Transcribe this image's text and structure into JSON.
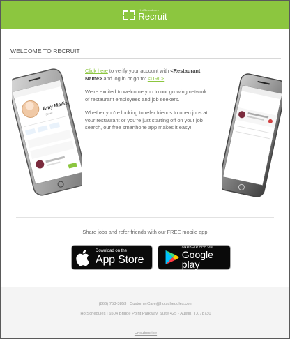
{
  "header": {
    "logo_small": "HotSchedules",
    "logo_name": "Recruit",
    "bg_color": "#8cc63f"
  },
  "welcome_title": "WELCOME TO RECRUIT",
  "intro": {
    "link_text": "Click here",
    "line1_rest": " to verify your account with ",
    "restaurant_placeholder": "<Restaurant Name>",
    "line1_end": " and log in or go to: ",
    "url_placeholder": "<URL>",
    "para2": "We're excited to welcome you to our growing network of restaurant employees and job seekers.",
    "para3": "Whether you're looking to refer friends to open jobs at your restaurant or you're just starting off on your job search, our free smarthone app makes it easy!"
  },
  "phone_left": {
    "profile_name": "Amy Mellis",
    "profile_sub": "Server"
  },
  "share_text": "Share jobs and refer friends with our FREE mobile app.",
  "app_store": {
    "small": "Download on the",
    "big": "App Store"
  },
  "google_play": {
    "small": "ANDROID APP ON",
    "big": "Google play"
  },
  "footer": {
    "contact": "(866) 753-3853 | CustomerCare@hotschedules.com",
    "address": "HotSchedules | 6504 Bridge Point Parkway, Suite 425 - Austin, TX 78730",
    "unsubscribe": "Unsubscribe"
  }
}
